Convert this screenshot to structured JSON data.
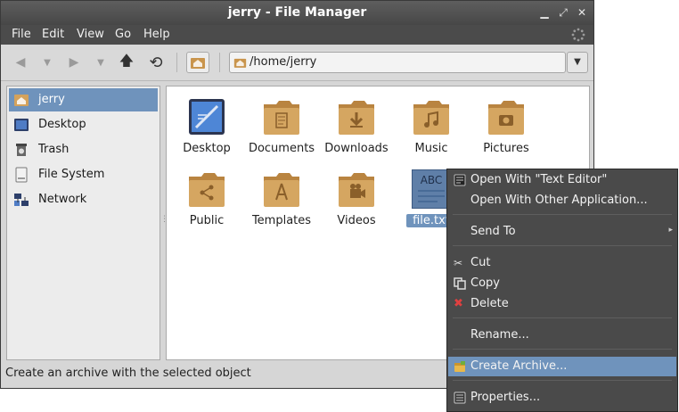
{
  "window": {
    "title": "jerry - File Manager",
    "controls": [
      "minimize-icon",
      "maximize-icon",
      "close-icon"
    ]
  },
  "menubar": {
    "items": [
      "File",
      "Edit",
      "View",
      "Go",
      "Help"
    ]
  },
  "toolbar": {
    "buttons": [
      "back-icon",
      "back-history-icon",
      "forward-icon",
      "forward-history-icon",
      "up-icon",
      "reload-icon",
      "home-icon"
    ],
    "location": "/home/jerry"
  },
  "sidebar": {
    "items": [
      {
        "label": "jerry",
        "icon": "home-folder-icon",
        "selected": true
      },
      {
        "label": "Desktop",
        "icon": "desktop-icon"
      },
      {
        "label": "Trash",
        "icon": "trash-icon"
      },
      {
        "label": "File System",
        "icon": "drive-icon"
      },
      {
        "label": "Network",
        "icon": "network-icon"
      }
    ]
  },
  "files": [
    {
      "label": "Desktop",
      "icon": "desktop-icon"
    },
    {
      "label": "Documents",
      "icon": "documents-folder-icon"
    },
    {
      "label": "Downloads",
      "icon": "downloads-folder-icon"
    },
    {
      "label": "Music",
      "icon": "music-folder-icon"
    },
    {
      "label": "Pictures",
      "icon": "pictures-folder-icon"
    },
    {
      "label": "Public",
      "icon": "public-folder-icon"
    },
    {
      "label": "Templates",
      "icon": "templates-folder-icon"
    },
    {
      "label": "Videos",
      "icon": "videos-folder-icon"
    },
    {
      "label": "file.txt",
      "icon": "text-file-icon",
      "thumb_text": "ABC",
      "selected": true
    }
  ],
  "status": "Create an archive with the selected object",
  "context_menu": {
    "items": [
      {
        "label": "Open With \"Text Editor\"",
        "icon": "text-editor-icon"
      },
      {
        "label": "Open With Other Application..."
      },
      {
        "label": "Send To",
        "submenu": "▸"
      },
      {
        "label": "Cut",
        "icon": "scissors-icon"
      },
      {
        "label": "Copy",
        "icon": "copy-icon"
      },
      {
        "label": "Delete",
        "icon": "delete-icon"
      },
      {
        "label": "Rename..."
      },
      {
        "label": "Create Archive...",
        "icon": "archive-icon",
        "highlighted": true
      },
      {
        "label": "Properties...",
        "icon": "properties-icon"
      }
    ]
  },
  "colors": {
    "selection": "#6f93bc",
    "folder": "#d3a460",
    "titlebar": "#4b4b4b",
    "menu_bg": "#4a4a4a"
  }
}
